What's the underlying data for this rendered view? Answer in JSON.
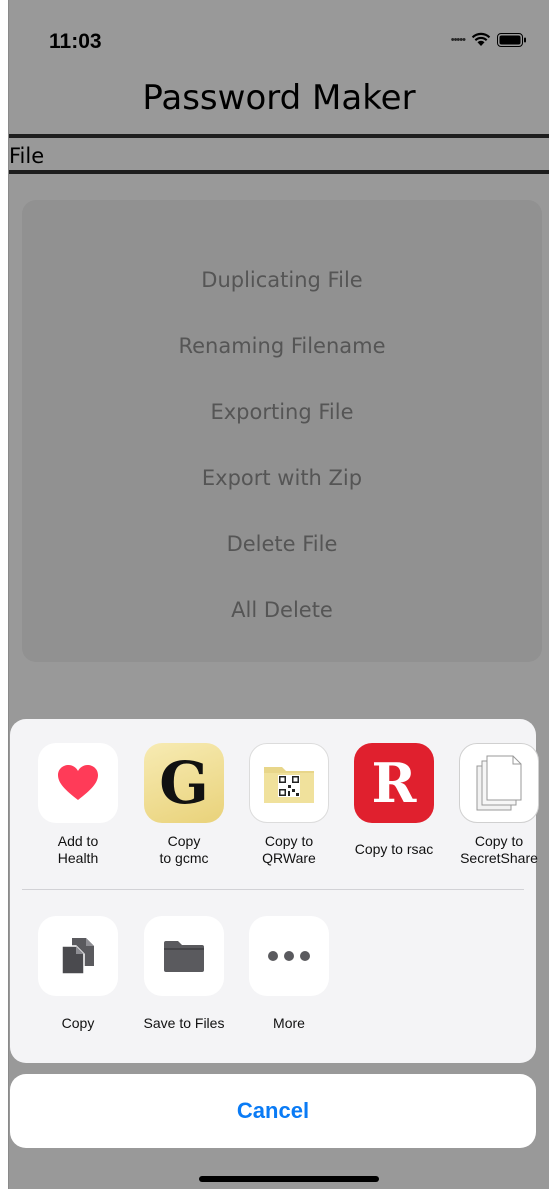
{
  "status_bar": {
    "time": "11:03"
  },
  "app": {
    "title": "Password Maker",
    "section_label": "File"
  },
  "menu": {
    "items": [
      "Duplicating File",
      "Renaming Filename",
      "Exporting File",
      "Export with Zip",
      "Delete File",
      "All Delete"
    ]
  },
  "share_sheet": {
    "apps": [
      {
        "label": "Add to\nHealth",
        "icon": "heart-icon"
      },
      {
        "label": "Copy\nto gcmc",
        "icon": "gcmc-g-icon",
        "glyph": "G"
      },
      {
        "label": "Copy to\nQRWare",
        "icon": "qrware-folder-icon"
      },
      {
        "label": "Copy to rsac",
        "icon": "rsac-r-icon",
        "glyph": "R"
      },
      {
        "label": "Copy to\nSecretShare",
        "icon": "secretshare-documents-icon"
      }
    ],
    "actions": [
      {
        "label": "Copy",
        "icon": "copy-icon"
      },
      {
        "label": "Save to Files",
        "icon": "folder-icon"
      },
      {
        "label": "More",
        "icon": "more-icon"
      }
    ],
    "cancel_label": "Cancel"
  },
  "colors": {
    "accent": "#0a7bf5",
    "menu_text": "#8e8e8e",
    "rsac_red": "#e0202e",
    "gcmc_gold": "#f0dc8c",
    "heart": "#ff3b58"
  }
}
